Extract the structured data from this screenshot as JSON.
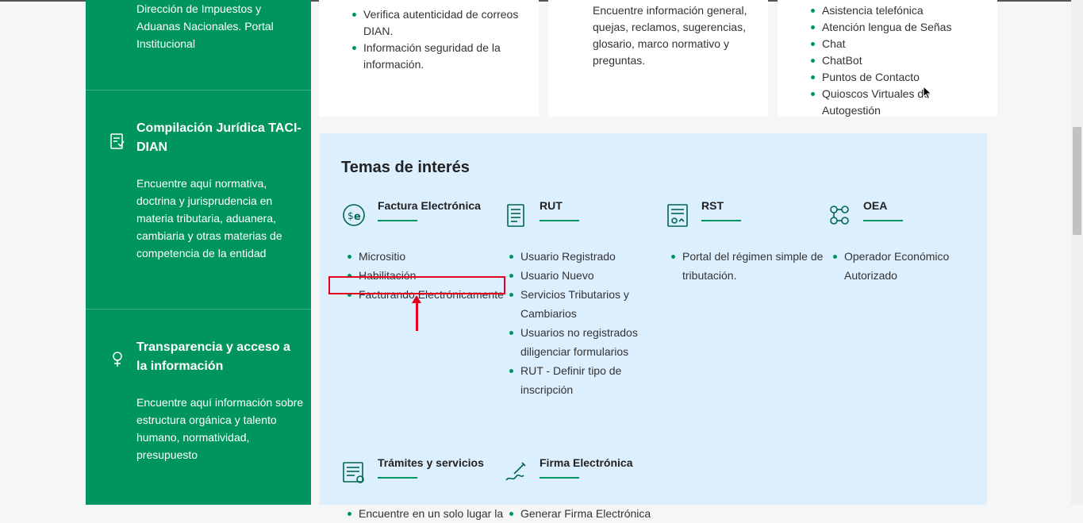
{
  "left_panel": {
    "section1": {
      "desc": "Dirección de Impuestos y Aduanas Nacionales. Portal Institucional"
    },
    "section2": {
      "title": "Compilación Jurídica TACI-DIAN",
      "desc": "Encuentre aquí normativa, doctrina y jurisprudencia en materia tributaria, aduanera, cambiaria y otras materias de competencia de la entidad",
      "icon": "document-scale-icon"
    },
    "section3": {
      "title": "Transparencia y acceso a la información",
      "desc": "Encuentre aquí información sobre estructura orgánica y talento humano, normatividad, presupuesto",
      "icon": "magnifier-icon"
    }
  },
  "cards": {
    "card1": {
      "items": [
        "Verifica autenticidad de correos DIAN.",
        "Información seguridad de la información."
      ]
    },
    "card2": {
      "text": "Encuentre información general, quejas, reclamos, sugerencias, glosario, marco normativo y preguntas."
    },
    "card3": {
      "items": [
        "Asistencia telefónica",
        "Atención lengua de Señas",
        "Chat",
        "ChatBot",
        "Puntos de Contacto",
        "Quioscos Virtuales de Autogestión"
      ]
    }
  },
  "interest": {
    "title": "Temas de interés",
    "topics": [
      {
        "name": "Factura Electrónica",
        "icon": "dollar-e-icon",
        "items": [
          "Micrositio",
          "Habilitación",
          "Facturando Electrónicamente"
        ]
      },
      {
        "name": "RUT",
        "icon": "document-lines-icon",
        "items": [
          "Usuario Registrado",
          "Usuario Nuevo",
          "Servicios Tributarios y Cambiarios",
          "Usuarios no registrados diligenciar formularios",
          "RUT - Definir tipo de inscripción"
        ]
      },
      {
        "name": "RST",
        "icon": "certificate-icon",
        "items": [
          "Portal del régimen simple de tributación."
        ]
      },
      {
        "name": "OEA",
        "icon": "network-people-icon",
        "items": [
          "Operador Económico Autorizado"
        ]
      },
      {
        "name": "Trámites y servicios",
        "icon": "form-list-icon",
        "items": [
          "Encuentre en un solo lugar la"
        ]
      },
      {
        "name": "Firma Electrónica",
        "icon": "signature-pen-icon",
        "items": [
          "Generar Firma Electrónica"
        ]
      }
    ]
  },
  "colors": {
    "green": "#00955e",
    "light_blue": "#dcefff",
    "highlight_red": "#e2001a"
  }
}
